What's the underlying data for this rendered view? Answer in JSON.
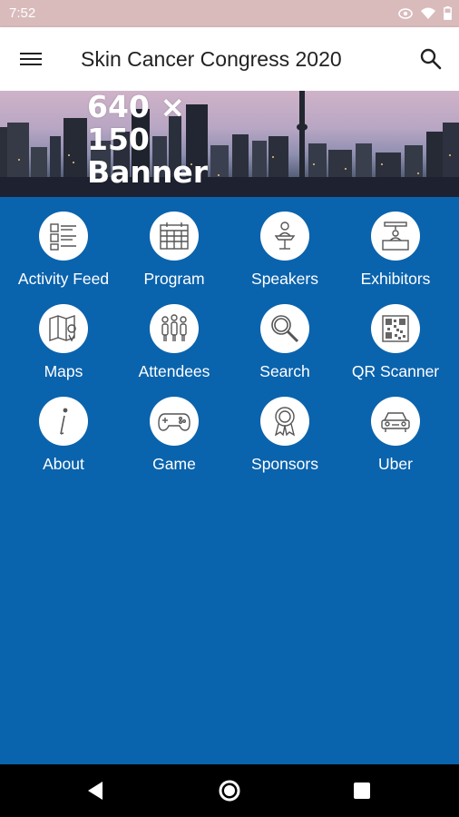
{
  "status_bar": {
    "time": "7:52"
  },
  "toolbar": {
    "title": "Skin Cancer Congress 2020"
  },
  "banner": {
    "line1": "640 ×",
    "line2": "150",
    "line3": "Banner"
  },
  "tiles": [
    {
      "label": "Activity Feed",
      "icon": "activity-feed-icon"
    },
    {
      "label": "Program",
      "icon": "calendar-icon"
    },
    {
      "label": "Speakers",
      "icon": "speaker-podium-icon"
    },
    {
      "label": "Exhibitors",
      "icon": "exhibitor-booth-icon"
    },
    {
      "label": "Maps",
      "icon": "map-icon"
    },
    {
      "label": "Attendees",
      "icon": "people-icon"
    },
    {
      "label": "Search",
      "icon": "magnifier-icon"
    },
    {
      "label": "QR Scanner",
      "icon": "qr-code-icon"
    },
    {
      "label": "About",
      "icon": "info-icon"
    },
    {
      "label": "Game",
      "icon": "gamepad-icon"
    },
    {
      "label": "Sponsors",
      "icon": "award-ribbon-icon"
    },
    {
      "label": "Uber",
      "icon": "car-icon"
    }
  ],
  "colors": {
    "background": "#0a63ad",
    "status_bar": "#d9bbbc",
    "toolbar": "#ffffff",
    "nav_bar": "#000000"
  }
}
